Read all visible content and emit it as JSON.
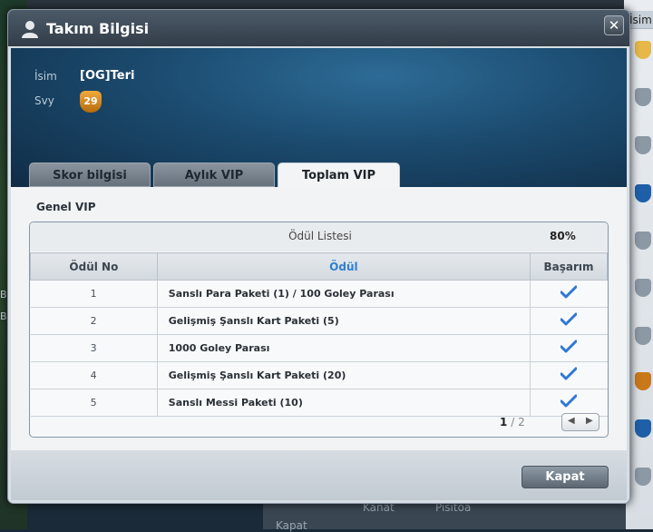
{
  "background": {
    "right_header": "İsim",
    "left_markers": [
      "B",
      "B"
    ],
    "bottom_labels": [
      "Kanat",
      "Pisitoa",
      "Kapat"
    ]
  },
  "dialog": {
    "title": "Takım Bilgisi",
    "close_label": "✕",
    "icons": {
      "title": "user-icon",
      "close": "close-icon",
      "check": "checkmark-icon"
    },
    "team": {
      "name_label": "İsim",
      "name_value": "[OG]Teri",
      "level_label": "Svy",
      "level_value": "29"
    },
    "tabs": [
      {
        "label": "Skor bilgisi",
        "active": false
      },
      {
        "label": "Aylık VIP",
        "active": false
      },
      {
        "label": "Toplam VIP",
        "active": true
      }
    ],
    "section_title": "Genel VIP",
    "reward_list": {
      "title": "Ödül Listesi",
      "progress": "80%",
      "columns": [
        "Ödül No",
        "Ödül",
        "Başarım"
      ],
      "rows": [
        {
          "no": "1",
          "reward": "Sanslı Para Paketi (1) / 100 Goley Parası",
          "achieved": true
        },
        {
          "no": "2",
          "reward": "Gelişmiş Şanslı Kart Paketi (5)",
          "achieved": true
        },
        {
          "no": "3",
          "reward": "1000 Goley Parası",
          "achieved": true
        },
        {
          "no": "4",
          "reward": "Gelişmiş Şanslı Kart Paketi (20)",
          "achieved": true
        },
        {
          "no": "5",
          "reward": "Sanslı Messi Paketi (10)",
          "achieved": true
        }
      ],
      "pagination": {
        "current": "1",
        "separator": "/",
        "total": "2",
        "prev": "◀",
        "next": "▶"
      }
    },
    "close_button": "Kapat"
  }
}
